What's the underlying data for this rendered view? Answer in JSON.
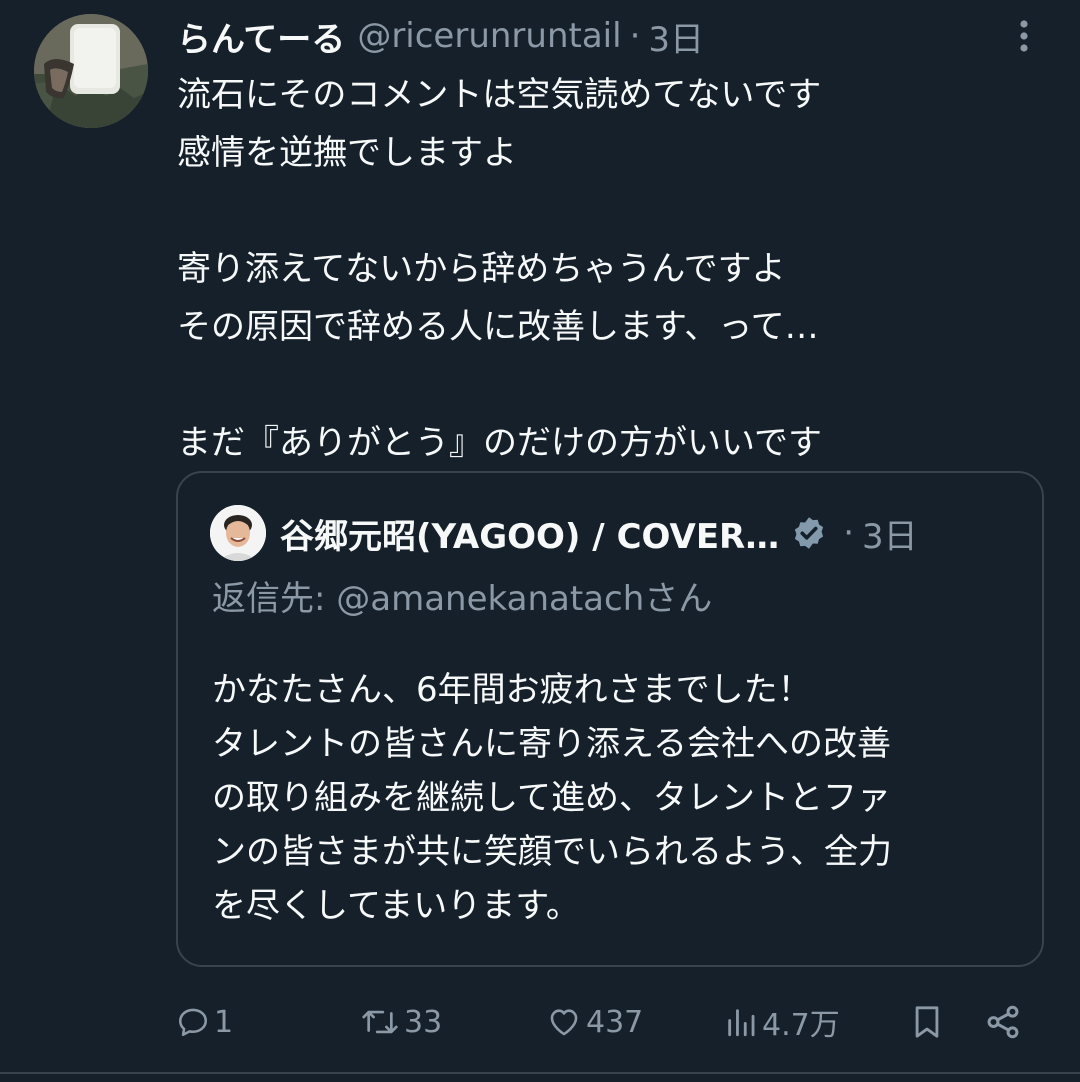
{
  "tweet": {
    "author": {
      "display_name": "らんてーる",
      "handle": "@ricerunruntail"
    },
    "separator": "·",
    "time": "3日",
    "lines": [
      "流石にそのコメントは空気読めてないです",
      "感情を逆撫でしますよ",
      "",
      "寄り添えてないから辞めちゃうんですよ",
      "その原因で辞める人に改善します、って…",
      "",
      "まだ『ありがとう』のだけの方がいいです"
    ]
  },
  "quote": {
    "author_name": "谷郷元昭(YAGOO) / COVER…",
    "separator": "·",
    "time": "3日",
    "reply_prefix": "返信先: ",
    "reply_handle": "@amanekanatach",
    "reply_suffix": "さん",
    "lines": [
      "かなたさん、6年間お疲れさまでした！",
      "タレントの皆さんに寄り添える会社への改善",
      "の取り組みを継続して進め、タレントとファ",
      "ンの皆さまが共に笑顔でいられるよう、全力",
      "を尽くしてまいります。"
    ]
  },
  "actions": {
    "replies": "1",
    "retweets": "33",
    "likes": "437",
    "views": "4.7万"
  },
  "icons": {
    "more": "more-vertical-icon",
    "verified": "verified-badge-icon",
    "reply": "reply-icon",
    "retweet": "retweet-icon",
    "like": "heart-icon",
    "views": "views-icon",
    "bookmark": "bookmark-icon",
    "share": "share-icon"
  },
  "colors": {
    "background": "#15202b",
    "primary_text": "#f7f9f9",
    "secondary_text": "#8b98a5",
    "border": "#38444d",
    "verified_badge": "#829aab"
  }
}
